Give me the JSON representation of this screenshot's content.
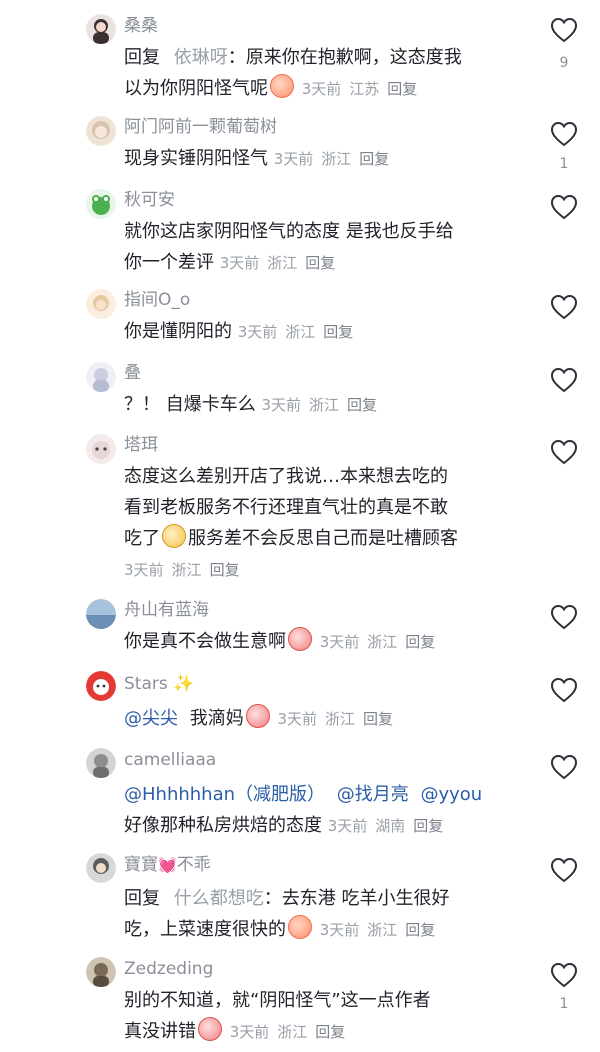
{
  "comments": [
    {
      "id": "c1",
      "username": "桑桑",
      "prefix": "回复",
      "reply_to": "依琳呀",
      "line1": "：原来你在抱歉啊，这态度我",
      "line2": "以为你阴阳怪气呢",
      "time": "3天前",
      "location": "江苏",
      "reply": "回复",
      "likes": "9",
      "avatar_color": "#3b2f2f"
    },
    {
      "id": "c2",
      "username": "阿门阿前一颗葡萄树",
      "line1": "现身实锤阴阳怪气",
      "time": "3天前",
      "location": "浙江",
      "reply": "回复",
      "likes": "1",
      "avatar_color": "#d9c3b0"
    },
    {
      "id": "c3",
      "username": "秋可安",
      "line1": "就你这店家阴阳怪气的态度 是我也反手给",
      "line2": "你一个差评",
      "time": "3天前",
      "location": "浙江",
      "reply": "回复",
      "avatar_color": "#4caf50"
    },
    {
      "id": "c4",
      "username": "指间O_o",
      "line1": "你是懂阴阳的",
      "time": "3天前",
      "location": "浙江",
      "reply": "回复",
      "avatar_color": "#e7c9a0"
    },
    {
      "id": "c5",
      "username": "叠",
      "line1": "？！ 自爆卡车么",
      "time": "3天前",
      "location": "浙江",
      "reply": "回复",
      "avatar_color": "#c9cfe0"
    },
    {
      "id": "c6",
      "username": "塔珥",
      "line1": "态度这么差别开店了我说…本来想去吃的",
      "line2": "看到老板服务不行还理直气壮的真是不敢",
      "line3a": "吃了",
      "line3b": "服务差不会反思自己而是吐槽顾客",
      "time": "3天前",
      "location": "浙江",
      "reply": "回复",
      "avatar_color": "#e8d5d5"
    },
    {
      "id": "c7",
      "username": "舟山有蓝海",
      "line1": "你是真不会做生意啊",
      "time": "3天前",
      "location": "浙江",
      "reply": "回复",
      "avatar_color": "#6b8fb5"
    },
    {
      "id": "c8",
      "username": "Stars",
      "mention": "@尖尖",
      "line1": "我滴妈",
      "time": "3天前",
      "location": "浙江",
      "reply": "回复",
      "avatar_color": "#e53935"
    },
    {
      "id": "c9",
      "username": "camelliaaa",
      "mentions": [
        "@Hhhhhhan（减肥版）",
        "@找月亮",
        "@yyou"
      ],
      "line1": "好像那种私房烘焙的态度",
      "time": "3天前",
      "location": "湖南",
      "reply": "回复",
      "avatar_color": "#8d8d8d"
    },
    {
      "id": "c10",
      "username_a": "寶寶",
      "username_b": "不乖",
      "prefix": "回复",
      "reply_to": "什么都想吃",
      "line1": "：去东港 吃羊小生很好",
      "line2": "吃，上菜速度很快的",
      "time": "3天前",
      "location": "浙江",
      "reply": "回复",
      "avatar_color": "#5d5d5d"
    },
    {
      "id": "c11",
      "username": "Zedzeding",
      "line1": "别的不知道，就“阴阳怪气”这一点作者",
      "line2": "真没讲错",
      "time": "3天前",
      "location": "浙江",
      "reply": "回复",
      "likes": "1",
      "avatar_color": "#7a6a55"
    }
  ]
}
